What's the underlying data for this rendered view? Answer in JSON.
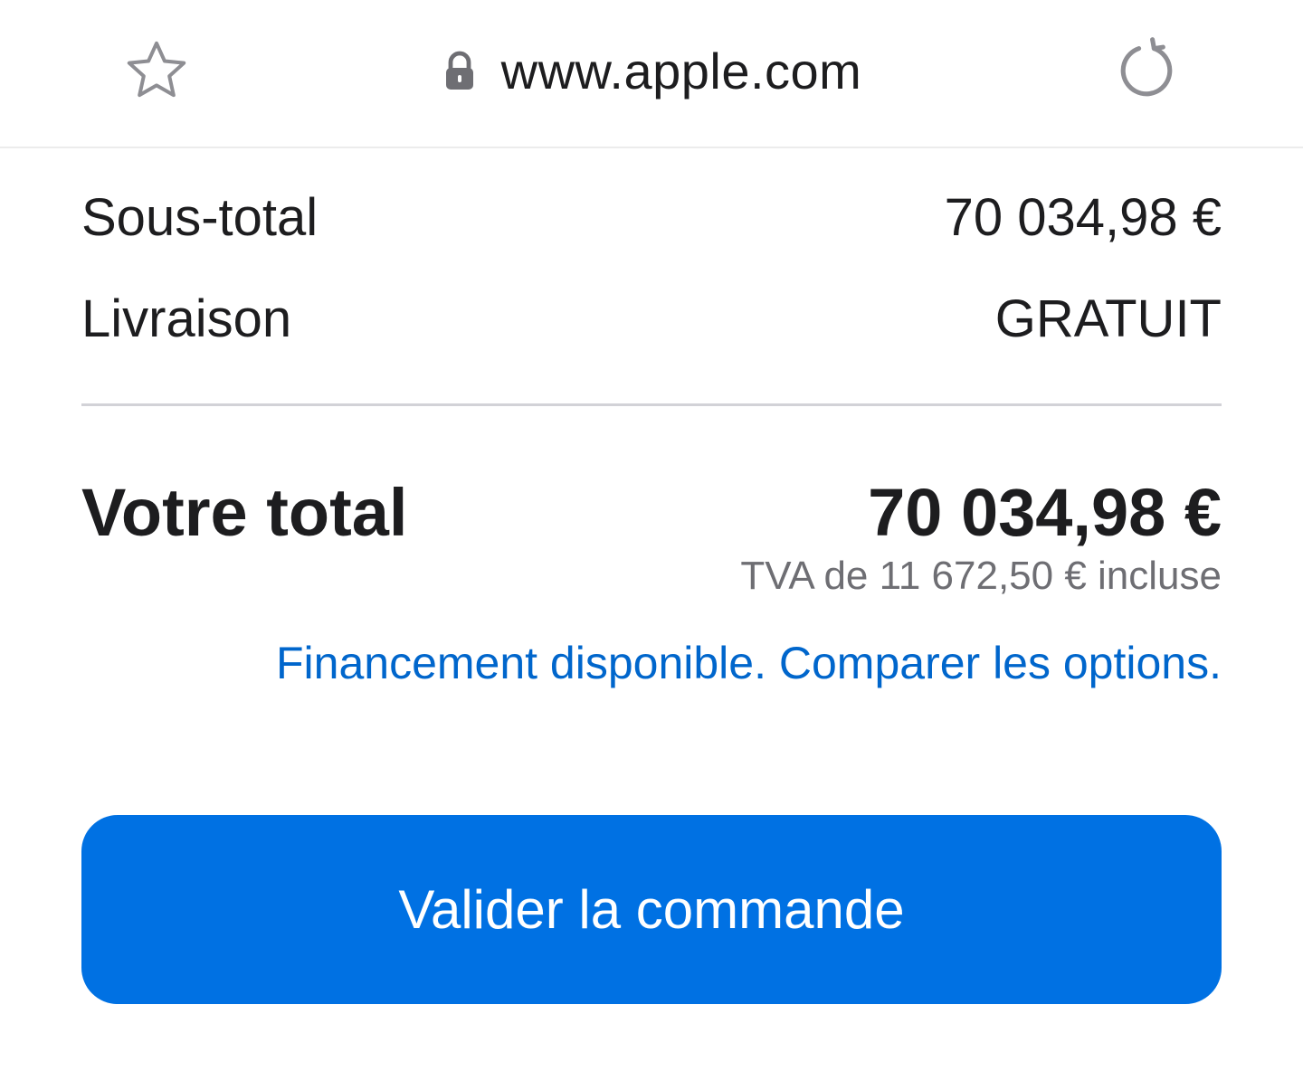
{
  "browser": {
    "url": "www.apple.com",
    "icons": {
      "bookmark": "star-outline-icon",
      "secure": "lock-icon",
      "reload": "reload-icon"
    },
    "icon_color": "#8e8e93"
  },
  "summary": {
    "subtotal_label": "Sous-total",
    "subtotal_value": "70 034,98 €",
    "shipping_label": "Livraison",
    "shipping_value": "GRATUIT",
    "total_label": "Votre total",
    "total_value": "70 034,98 €",
    "vat_note": "TVA de 11 672,50 € incluse",
    "financing_link": "Financement disponible. Comparer les options."
  },
  "actions": {
    "checkout_label": "Valider la commande"
  },
  "colors": {
    "text": "#1d1d1f",
    "secondary_text": "#6e6e73",
    "link": "#0066cc",
    "button": "#0071e3",
    "divider": "#d2d2d7"
  }
}
